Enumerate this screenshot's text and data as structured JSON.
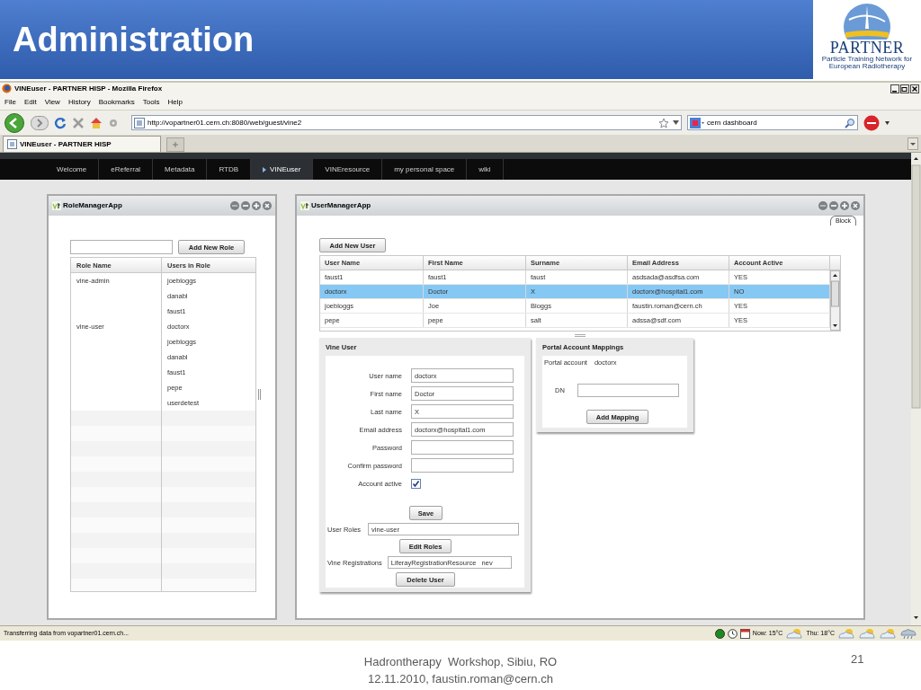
{
  "slide": {
    "title": "Administration",
    "logo_text": "PARTNER",
    "logo_subtitle": "Particle Training Network for European Radiotherapy"
  },
  "browser": {
    "title": "VINEuser - PARTNER HISP - Mozilla Firefox",
    "menu": [
      "File",
      "Edit",
      "View",
      "History",
      "Bookmarks",
      "Tools",
      "Help"
    ],
    "url": "http://vopartner01.cern.ch:8080/web/guest/vine2",
    "search": "cern dashboard",
    "tabs": [
      {
        "label": "VINEuser - PARTNER HISP",
        "selected": true
      }
    ],
    "status": "Transferring data from vopartner01.cern.ch...",
    "weather": [
      "Now: 15°C",
      "Thu: 18°C"
    ]
  },
  "site_nav": [
    {
      "label": "Welcome",
      "selected": false
    },
    {
      "label": "eReferral",
      "selected": false
    },
    {
      "label": "Metadata",
      "selected": false
    },
    {
      "label": "RTDB",
      "selected": false
    },
    {
      "label": "VINEuser",
      "selected": true
    },
    {
      "label": "VINEresource",
      "selected": false
    },
    {
      "label": "my personal space",
      "selected": false
    },
    {
      "label": "wiki",
      "selected": false
    }
  ],
  "role_manager": {
    "title": "RoleManagerApp",
    "add_button": "Add New Role",
    "columns": [
      "Role Name",
      "Users in Role"
    ],
    "rows": [
      {
        "role": "vine-admin",
        "users": [
          "joebloggs",
          "danabl",
          "faust1"
        ]
      },
      {
        "role": "vine-user",
        "users": [
          "doctorx",
          "joebloggs",
          "danabl",
          "faust1",
          "pepe",
          "userdetest"
        ]
      }
    ]
  },
  "user_manager": {
    "title": "UserManagerApp",
    "block_tab": "Block",
    "add_button": "Add New User",
    "columns": [
      "User Name",
      "First Name",
      "Surname",
      "Email Address",
      "Account Active"
    ],
    "rows": [
      {
        "cells": [
          "faust1",
          "faust1",
          "faust",
          "asdsada@asdfsa.com",
          "YES"
        ],
        "selected": false
      },
      {
        "cells": [
          "doctorx",
          "Doctor",
          "X",
          "doctorx@hospital1.com",
          "NO"
        ],
        "selected": true
      },
      {
        "cells": [
          "joebloggs",
          "Joe",
          "Bloggs",
          "faustin.roman@cern.ch",
          "YES"
        ],
        "selected": false
      },
      {
        "cells": [
          "pepe",
          "pepe",
          "salt",
          "adssa@sdf.com",
          "YES"
        ],
        "selected": false
      }
    ],
    "vine_user": {
      "title": "Vine User",
      "fields": [
        {
          "kind": "text",
          "label": "User name",
          "value": "doctorx"
        },
        {
          "kind": "text",
          "label": "First name",
          "value": "Doctor"
        },
        {
          "kind": "text",
          "label": "Last name",
          "value": "X"
        },
        {
          "kind": "text",
          "label": "Email address",
          "value": "doctorx@hospital1.com"
        },
        {
          "kind": "text",
          "label": "Password"
        },
        {
          "kind": "text",
          "label": "Confirm password"
        },
        {
          "kind": "checkbox",
          "label": "Account active",
          "checked": true
        }
      ],
      "save": "Save",
      "roles_label": "User Roles",
      "roles_value": "vine-user",
      "edit_roles": "Edit Roles",
      "registrations_label": "Vine Registrations",
      "registrations_value": "LiferayRegistrationResource   nev",
      "delete": "Delete User"
    },
    "portal_mappings": {
      "title": "Portal Account Mappings",
      "account_label": "Portal account",
      "account_value": "doctorx",
      "dn_label": "DN",
      "add_mapping": "Add Mapping"
    }
  },
  "footer": {
    "lines": [
      "Hadrontherapy  Workshop, Sibiu, RO",
      "12.11.2010, faustin.roman@cern.ch"
    ],
    "page": "21"
  }
}
